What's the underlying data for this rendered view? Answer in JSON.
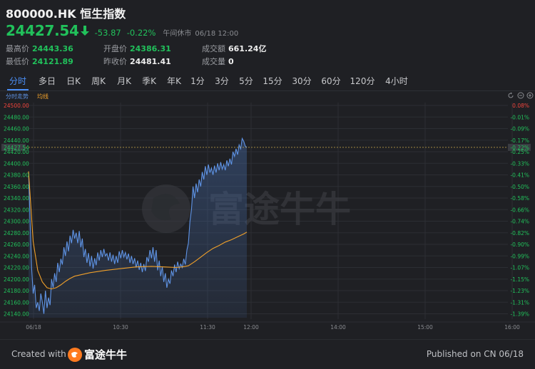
{
  "header": {
    "symbol_title": "800000.HK 恒生指数",
    "price": "24427.54",
    "change": "-53.87",
    "change_pct": "-0.22%",
    "status": "午间休市",
    "datetime": "06/18 12:00"
  },
  "quote": {
    "high_label": "最高价",
    "high": "24443.36",
    "low_label": "最低价",
    "low": "24121.89",
    "open_label": "开盘价",
    "open": "24386.31",
    "prev_close_label": "昨收价",
    "prev_close": "24481.41",
    "turnover_label": "成交额",
    "turnover": "661.24亿",
    "volume_label": "成交量",
    "volume": "0"
  },
  "tabs": [
    "分时",
    "多日",
    "日K",
    "周K",
    "月K",
    "季K",
    "年K",
    "1分",
    "3分",
    "5分",
    "15分",
    "30分",
    "60分",
    "120分",
    "4小时"
  ],
  "active_tab": "分时",
  "colors": {
    "down": "#21c15b",
    "up": "#f0443c",
    "price_line": "#5f94e6",
    "avg_line": "#f0a02a",
    "active_tab": "#4b8ff8"
  },
  "watermark": "富途牛牛",
  "footer": {
    "created_with": "Created with",
    "logo_text": "富途牛牛",
    "published": "Published on CN 06/18"
  },
  "chart_data": {
    "type": "line",
    "legend": [
      "分时走势",
      "均线"
    ],
    "prev_close": 24481.41,
    "ylim": [
      24130,
      24500
    ],
    "y_ticks": [
      "24500.00",
      "24480.00",
      "24460.00",
      "24440.00",
      "24420.00",
      "24400.00",
      "24380.00",
      "24360.00",
      "24340.00",
      "24320.00",
      "24300.00",
      "24280.00",
      "24260.00",
      "24240.00",
      "24220.00",
      "24200.00",
      "24180.00",
      "24160.00",
      "24140.00"
    ],
    "pct_ticks": [
      "0.08%",
      "-0.01%",
      "-0.09%",
      "-0.17%",
      "-0.25%",
      "-0.33%",
      "-0.41%",
      "-0.50%",
      "-0.58%",
      "-0.66%",
      "-0.74%",
      "-0.82%",
      "-0.90%",
      "-0.99%",
      "-1.07%",
      "-1.15%",
      "-1.23%",
      "-1.31%",
      "-1.39%"
    ],
    "x_ticks": [
      "06/18",
      "10:30",
      "11:30",
      "12:00",
      "14:00",
      "15:00",
      "16:00"
    ],
    "current_price_label": "24427.54",
    "current_pct_label": "-0.22%",
    "session_minutes": 390,
    "price": [
      [
        0,
        24386
      ],
      [
        1,
        24300
      ],
      [
        2,
        24220
      ],
      [
        3,
        24175
      ],
      [
        4,
        24190
      ],
      [
        5,
        24150
      ],
      [
        6,
        24160
      ],
      [
        7,
        24145
      ],
      [
        8,
        24175
      ],
      [
        9,
        24160
      ],
      [
        10,
        24140
      ],
      [
        11,
        24180
      ],
      [
        12,
        24150
      ],
      [
        13,
        24168
      ],
      [
        14,
        24155
      ],
      [
        15,
        24200
      ],
      [
        16,
        24185
      ],
      [
        17,
        24210
      ],
      [
        18,
        24195
      ],
      [
        19,
        24228
      ],
      [
        20,
        24212
      ],
      [
        21,
        24235
      ],
      [
        22,
        24225
      ],
      [
        23,
        24255
      ],
      [
        24,
        24240
      ],
      [
        25,
        24265
      ],
      [
        26,
        24248
      ],
      [
        27,
        24275
      ],
      [
        28,
        24262
      ],
      [
        29,
        24285
      ],
      [
        30,
        24270
      ],
      [
        31,
        24280
      ],
      [
        32,
        24262
      ],
      [
        33,
        24283
      ],
      [
        34,
        24255
      ],
      [
        35,
        24270
      ],
      [
        36,
        24238
      ],
      [
        37,
        24252
      ],
      [
        38,
        24228
      ],
      [
        39,
        24245
      ],
      [
        40,
        24222
      ],
      [
        41,
        24240
      ],
      [
        42,
        24218
      ],
      [
        43,
        24236
      ],
      [
        44,
        24224
      ],
      [
        45,
        24246
      ],
      [
        46,
        24232
      ],
      [
        47,
        24250
      ],
      [
        48,
        24238
      ],
      [
        49,
        24252
      ],
      [
        50,
        24240
      ],
      [
        51,
        24244
      ],
      [
        52,
        24232
      ],
      [
        53,
        24246
      ],
      [
        54,
        24230
      ],
      [
        55,
        24242
      ],
      [
        56,
        24226
      ],
      [
        57,
        24240
      ],
      [
        58,
        24228
      ],
      [
        59,
        24248
      ],
      [
        60,
        24236
      ],
      [
        61,
        24250
      ],
      [
        62,
        24238
      ],
      [
        63,
        24246
      ],
      [
        64,
        24234
      ],
      [
        65,
        24244
      ],
      [
        66,
        24228
      ],
      [
        67,
        24240
      ],
      [
        68,
        24226
      ],
      [
        69,
        24236
      ],
      [
        70,
        24220
      ],
      [
        71,
        24232
      ],
      [
        72,
        24216
      ],
      [
        73,
        24228
      ],
      [
        74,
        24212
      ],
      [
        75,
        24226
      ],
      [
        76,
        24214
      ],
      [
        77,
        24238
      ],
      [
        78,
        24230
      ],
      [
        79,
        24250
      ],
      [
        80,
        24236
      ],
      [
        81,
        24255
      ],
      [
        82,
        24230
      ],
      [
        83,
        24250
      ],
      [
        84,
        24215
      ],
      [
        85,
        24232
      ],
      [
        86,
        24205
      ],
      [
        87,
        24222
      ],
      [
        88,
        24195
      ],
      [
        89,
        24210
      ],
      [
        90,
        24185
      ],
      [
        91,
        24200
      ],
      [
        92,
        24192
      ],
      [
        93,
        24215
      ],
      [
        94,
        24205
      ],
      [
        95,
        24225
      ],
      [
        96,
        24212
      ],
      [
        97,
        24230
      ],
      [
        98,
        24218
      ],
      [
        99,
        24226
      ],
      [
        100,
        24220
      ],
      [
        101,
        24235
      ],
      [
        102,
        24225
      ],
      [
        103,
        24250
      ],
      [
        104,
        24262
      ],
      [
        105,
        24300
      ],
      [
        106,
        24320
      ],
      [
        107,
        24360
      ],
      [
        108,
        24340
      ],
      [
        109,
        24365
      ],
      [
        110,
        24350
      ],
      [
        111,
        24372
      ],
      [
        112,
        24360
      ],
      [
        113,
        24385
      ],
      [
        114,
        24372
      ],
      [
        115,
        24395
      ],
      [
        116,
        24380
      ],
      [
        117,
        24398
      ],
      [
        118,
        24384
      ],
      [
        119,
        24392
      ],
      [
        120,
        24380
      ],
      [
        121,
        24396
      ],
      [
        122,
        24384
      ],
      [
        123,
        24400
      ],
      [
        124,
        24388
      ],
      [
        125,
        24402
      ],
      [
        126,
        24390
      ],
      [
        127,
        24398
      ],
      [
        128,
        24388
      ],
      [
        129,
        24405
      ],
      [
        130,
        24395
      ],
      [
        131,
        24408
      ],
      [
        132,
        24398
      ],
      [
        133,
        24420
      ],
      [
        134,
        24412
      ],
      [
        135,
        24425
      ],
      [
        136,
        24415
      ],
      [
        137,
        24432
      ],
      [
        138,
        24425
      ],
      [
        139,
        24443
      ],
      [
        140,
        24438
      ],
      [
        141,
        24430
      ],
      [
        142,
        24427.54
      ]
    ],
    "avg": [
      [
        0,
        24386
      ],
      [
        3,
        24265
      ],
      [
        6,
        24215
      ],
      [
        9,
        24195
      ],
      [
        12,
        24185
      ],
      [
        15,
        24183
      ],
      [
        18,
        24185
      ],
      [
        21,
        24190
      ],
      [
        24,
        24196
      ],
      [
        27,
        24201
      ],
      [
        30,
        24205
      ],
      [
        40,
        24211
      ],
      [
        50,
        24215
      ],
      [
        60,
        24218
      ],
      [
        70,
        24221
      ],
      [
        80,
        24222
      ],
      [
        88,
        24221
      ],
      [
        96,
        24220
      ],
      [
        100,
        24221
      ],
      [
        104,
        24223
      ],
      [
        108,
        24230
      ],
      [
        112,
        24238
      ],
      [
        116,
        24246
      ],
      [
        120,
        24253
      ],
      [
        124,
        24258
      ],
      [
        128,
        24264
      ],
      [
        132,
        24268
      ],
      [
        136,
        24273
      ],
      [
        140,
        24278
      ],
      [
        142,
        24281
      ]
    ]
  }
}
